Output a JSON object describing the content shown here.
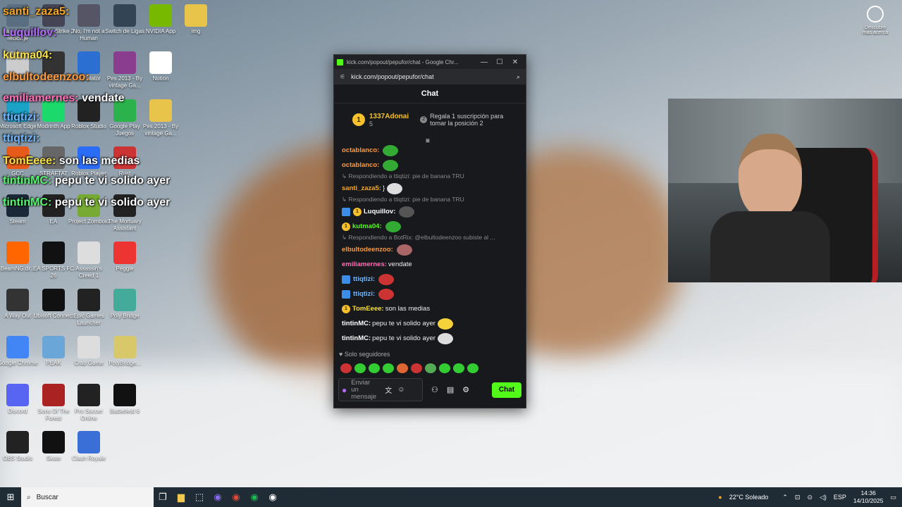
{
  "desktop": {
    "icons": [
      {
        "label": "Papelera de reciclaje",
        "icon": "recycle-bin-icon",
        "color": "#5a6e82"
      },
      {
        "label": "Counter-Strike 2",
        "icon": "cs2-icon",
        "color": "#445"
      },
      {
        "label": "No, I'm not a Human",
        "icon": "game-icon",
        "color": "#556"
      },
      {
        "label": "Switch de Ligas",
        "icon": "gta-icon",
        "color": "#345"
      },
      {
        "label": "NVIDIA App",
        "icon": "nvidia-icon",
        "color": "#76b900"
      },
      {
        "label": "Final",
        "icon": "trophy-icon",
        "color": "#ccc"
      },
      {
        "label": "Rainbow Si...",
        "icon": "rainbow-six-icon",
        "color": "#333"
      },
      {
        "label": "Simulator",
        "icon": "rocket-league-icon",
        "color": "#2a6fd1"
      },
      {
        "label": "Notion",
        "icon": "notion-icon",
        "color": "#fff"
      },
      {
        "label": "Microsoft Edge",
        "icon": "edge-icon",
        "color": "#1aa3c6"
      },
      {
        "label": "Modrinth App",
        "icon": "modrinth-icon",
        "color": "#1bd96a"
      },
      {
        "label": "Roblox Studio",
        "icon": "roblox-studio-icon",
        "color": "#222"
      },
      {
        "label": "Pes 2013 - By vintage Ga...",
        "icon": "winrar-icon",
        "color": "#8a3d8f"
      },
      {
        "label": "Pes 2013 - By vintage Ga...",
        "icon": "folder-icon",
        "color": "#e8c44a"
      },
      {
        "label": "img",
        "icon": "folder-icon",
        "color": "#e8c44a"
      },
      {
        "label": "GCC",
        "icon": "gcc-icon",
        "color": "#e85a1a"
      },
      {
        "label": "STRAFTAT",
        "icon": "straftat-icon",
        "color": "#666"
      },
      {
        "label": "Roblox Player",
        "icon": "roblox-icon",
        "color": "#2b6cf6"
      },
      {
        "label": "Google Play Juegos",
        "icon": "google-play-icon",
        "color": "#2bb24c"
      },
      {
        "label": "Steam",
        "icon": "steam-icon",
        "color": "#1b2838"
      },
      {
        "label": "EA",
        "icon": "ea-icon",
        "color": "#222"
      },
      {
        "label": "Project Zomboid",
        "icon": "zomboid-icon",
        "color": "#7a3"
      },
      {
        "label": "Rust",
        "icon": "rust-icon",
        "color": "#c33"
      },
      {
        "label": "BeamNG.dr...",
        "icon": "beamng-icon",
        "color": "#f60"
      },
      {
        "label": "EA SPORTS FC 26",
        "icon": "fc26-icon",
        "color": "#111"
      },
      {
        "label": "Assassin's Creed 1",
        "icon": "assassins-creed-icon",
        "color": "#ddd"
      },
      {
        "label": "The Mortuary Assistant",
        "icon": "mortuary-icon",
        "color": "#222"
      },
      {
        "label": "A Way Out",
        "icon": "a-way-out-icon",
        "color": "#333"
      },
      {
        "label": "Ubisoft Connect",
        "icon": "ubisoft-icon",
        "color": "#111"
      },
      {
        "label": "Epic Games Launcher",
        "icon": "epic-games-icon",
        "color": "#222"
      },
      {
        "label": "Peggle",
        "icon": "peggle-icon",
        "color": "#e33"
      },
      {
        "label": "Google Chrome",
        "icon": "chrome-icon",
        "color": "#4285f4"
      },
      {
        "label": "PEAK",
        "icon": "peak-icon",
        "color": "#6aa6d8"
      },
      {
        "label": "Crab Game",
        "icon": "crab-game-icon",
        "color": "#ddd"
      },
      {
        "label": "Poly Bridge",
        "icon": "poly-bridge-icon",
        "color": "#4a9"
      },
      {
        "label": "Discord",
        "icon": "discord-icon",
        "color": "#5865f2"
      },
      {
        "label": "Sons Of The Forest",
        "icon": "sons-forest-icon",
        "color": "#a22"
      },
      {
        "label": "Pro Soccer Online",
        "icon": "soccer-icon",
        "color": "#222"
      },
      {
        "label": "PolyBridge...",
        "icon": "file-icon",
        "color": "#d8c86a"
      },
      {
        "label": "OBS Studio",
        "icon": "obs-icon",
        "color": "#222"
      },
      {
        "label": "Skate",
        "icon": "skate-icon",
        "color": "#111"
      },
      {
        "label": "Clash Royale",
        "icon": "clash-royale-icon",
        "color": "#3a6fd8"
      },
      {
        "label": "Battlefield 6",
        "icon": "battlefield-icon",
        "color": "#111"
      }
    ],
    "discover_label": "Descubre más acerca",
    "overlay_chat": [
      {
        "user": "santi_zaza5:",
        "text": "",
        "color": "#f5a623"
      },
      {
        "user": "Luquillov:",
        "text": "",
        "color": "#b36bff"
      },
      {
        "user": "kutma04:",
        "text": "",
        "color": "#f7e043"
      },
      {
        "user": "elbultodeenzoo:",
        "text": "",
        "color": "#ff9a3c"
      },
      {
        "user": "emiliamernes:",
        "text": " vendate",
        "color": "#ff6fb5"
      },
      {
        "user": "ttiqtizi:",
        "text": "",
        "color": "#6fb6ff"
      },
      {
        "user": "ttiqtizi:",
        "text": "",
        "color": "#6fb6ff"
      },
      {
        "user": "TomEeee:",
        "text": " son las medias",
        "color": "#f7e043"
      },
      {
        "user": "tintinMC:",
        "text": " pepu te vi solido ayer",
        "color": "#58f56f"
      },
      {
        "user": "tintinMC:",
        "text": " pepu te vi solido ayer",
        "color": "#58f56f"
      }
    ]
  },
  "chat_window": {
    "title": "kick.com/popout/pepufor/chat - Google Chr...",
    "url": "kick.com/popout/pepufor/chat",
    "header": "Chat",
    "pinned": {
      "rank": "1",
      "name": "1337Adonai",
      "count": "5",
      "gift_text": "Regala 1 suscripción para tomar la posición 2",
      "gift_rank": "2"
    },
    "messages": [
      {
        "type": "msg",
        "user": "octablanco:",
        "color": "#ff9a3c",
        "text": "",
        "emote": "#3a3"
      },
      {
        "type": "msg",
        "user": "octablanco:",
        "color": "#ff9a3c",
        "text": "",
        "emote": "#3a3"
      },
      {
        "type": "reply",
        "text": "↳ Respondiendo a ttiqtizi: pie de banana TRU"
      },
      {
        "type": "msg",
        "user": "santi_zaza5:",
        "color": "#f5a623",
        "text": " }",
        "emote": "#ddd"
      },
      {
        "type": "reply",
        "text": "↳ Respondiendo a ttiqtizi: pie de banana TRU"
      },
      {
        "type": "msg",
        "user": "Luquillov:",
        "color": "#ffffff",
        "text": "",
        "emote": "#555",
        "badge": "#3a8ee8",
        "badge2": "1"
      },
      {
        "type": "msg",
        "user": "kutma04:",
        "color": "#53fc18",
        "text": "",
        "emote": "#3a3",
        "badge2": "1"
      },
      {
        "type": "reply",
        "text": "↳ Respondiendo a BotRix: @elbultodeenzoo subiste al ..."
      },
      {
        "type": "msg",
        "user": "elbultodeenzoo:",
        "color": "#ff9a3c",
        "text": "",
        "emote": "#a66"
      },
      {
        "type": "msg",
        "user": "emiliamernes:",
        "color": "#ff6fb5",
        "text": " vendate"
      },
      {
        "type": "msg",
        "user": "ttiqtizi:",
        "color": "#6fb6ff",
        "text": "",
        "emote": "#c33",
        "badge": "#3a8ee8"
      },
      {
        "type": "msg",
        "user": "ttiqtizi:",
        "color": "#6fb6ff",
        "text": "",
        "emote": "#c33",
        "badge": "#3a8ee8"
      },
      {
        "type": "msg",
        "user": "TomEeee:",
        "color": "#f7e043",
        "text": " son las medias",
        "badge2": "1"
      },
      {
        "type": "msg",
        "user": "tintinMC:",
        "color": "#ffffff",
        "text": " pepu te vi solido ayer",
        "emote": "#f6d23a"
      },
      {
        "type": "msg",
        "user": "tintinMC:",
        "color": "#ffffff",
        "text": " pepu te vi solido ayer",
        "emote": "#ddd"
      }
    ],
    "followers_label": "Solo seguidores",
    "input_placeholder": "Enviar un mensaje",
    "send_label": "Chat",
    "quick_emotes": [
      "#c33",
      "#3c3",
      "#3c3",
      "#3c3",
      "#d63",
      "#c33",
      "#5a5",
      "#3c3",
      "#3c3",
      "#3c3"
    ]
  },
  "taskbar": {
    "search_placeholder": "Buscar",
    "weather": "22°C  Soleado",
    "lang": "ESP",
    "time": "14:36",
    "date": "14/10/2025"
  }
}
